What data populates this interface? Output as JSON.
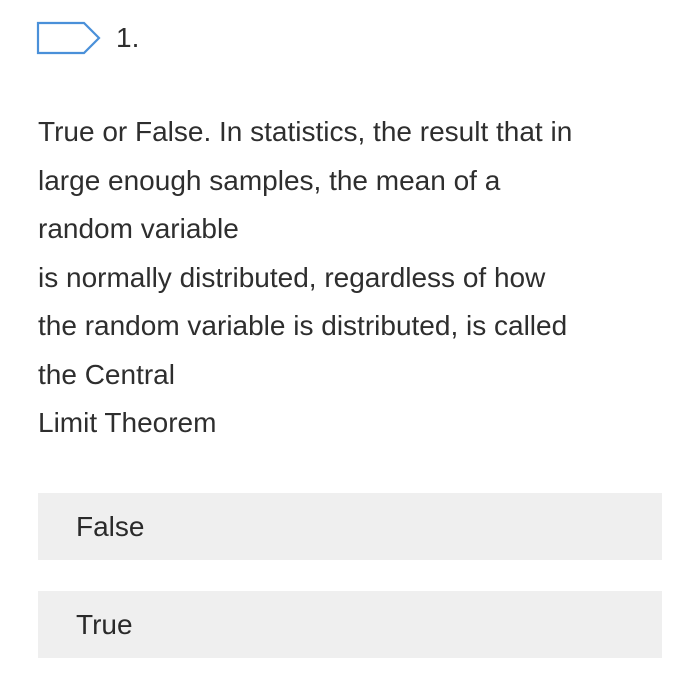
{
  "question": {
    "flag_icon": "flag-outline-icon",
    "accent_color": "#4a90d9",
    "number": "1.",
    "text_lines": [
      "True or False. In statistics, the result that in",
      "large enough samples, the mean of a",
      "random variable",
      "is normally distributed, regardless of how",
      "the random variable is distributed, is called",
      "the Central",
      "Limit Theorem"
    ]
  },
  "options": [
    {
      "label": "False"
    },
    {
      "label": "True"
    }
  ]
}
